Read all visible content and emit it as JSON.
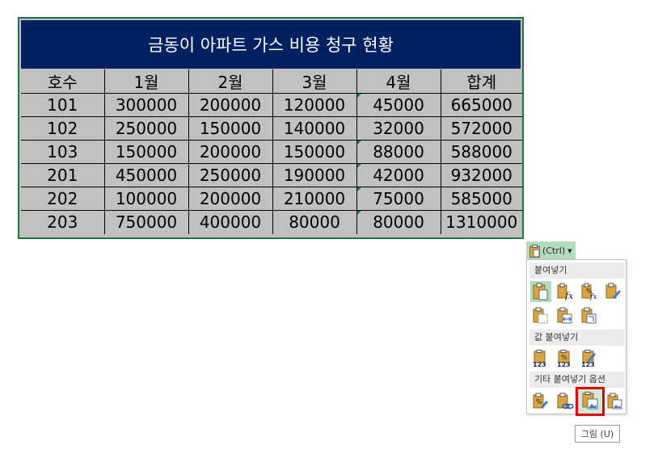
{
  "table": {
    "title": "금동이 아파트 가스 비용 청구 현황",
    "headers": [
      "호수",
      "1월",
      "2월",
      "3월",
      "4월",
      "합계"
    ],
    "rows": [
      [
        "101",
        "300000",
        "200000",
        "120000",
        "45000",
        "665000"
      ],
      [
        "102",
        "250000",
        "150000",
        "140000",
        "32000",
        "572000"
      ],
      [
        "103",
        "150000",
        "200000",
        "150000",
        "88000",
        "588000"
      ],
      [
        "201",
        "450000",
        "250000",
        "190000",
        "42000",
        "932000"
      ],
      [
        "202",
        "100000",
        "200000",
        "210000",
        "75000",
        "585000"
      ],
      [
        "203",
        "750000",
        "400000",
        "80000",
        "80000",
        "1310000"
      ]
    ]
  },
  "paste_options": {
    "button_label": "(Ctrl)",
    "sections": {
      "paste": "붙여넣기",
      "paste_values": "값 붙여넣기",
      "other": "기타 붙여넣기 옵션"
    },
    "tooltip": "그림 (U)"
  },
  "colors": {
    "title_bg": "#002060",
    "cell_bg": "#c0c0c0",
    "selection_border": "#217346",
    "highlight": "#e00000"
  }
}
